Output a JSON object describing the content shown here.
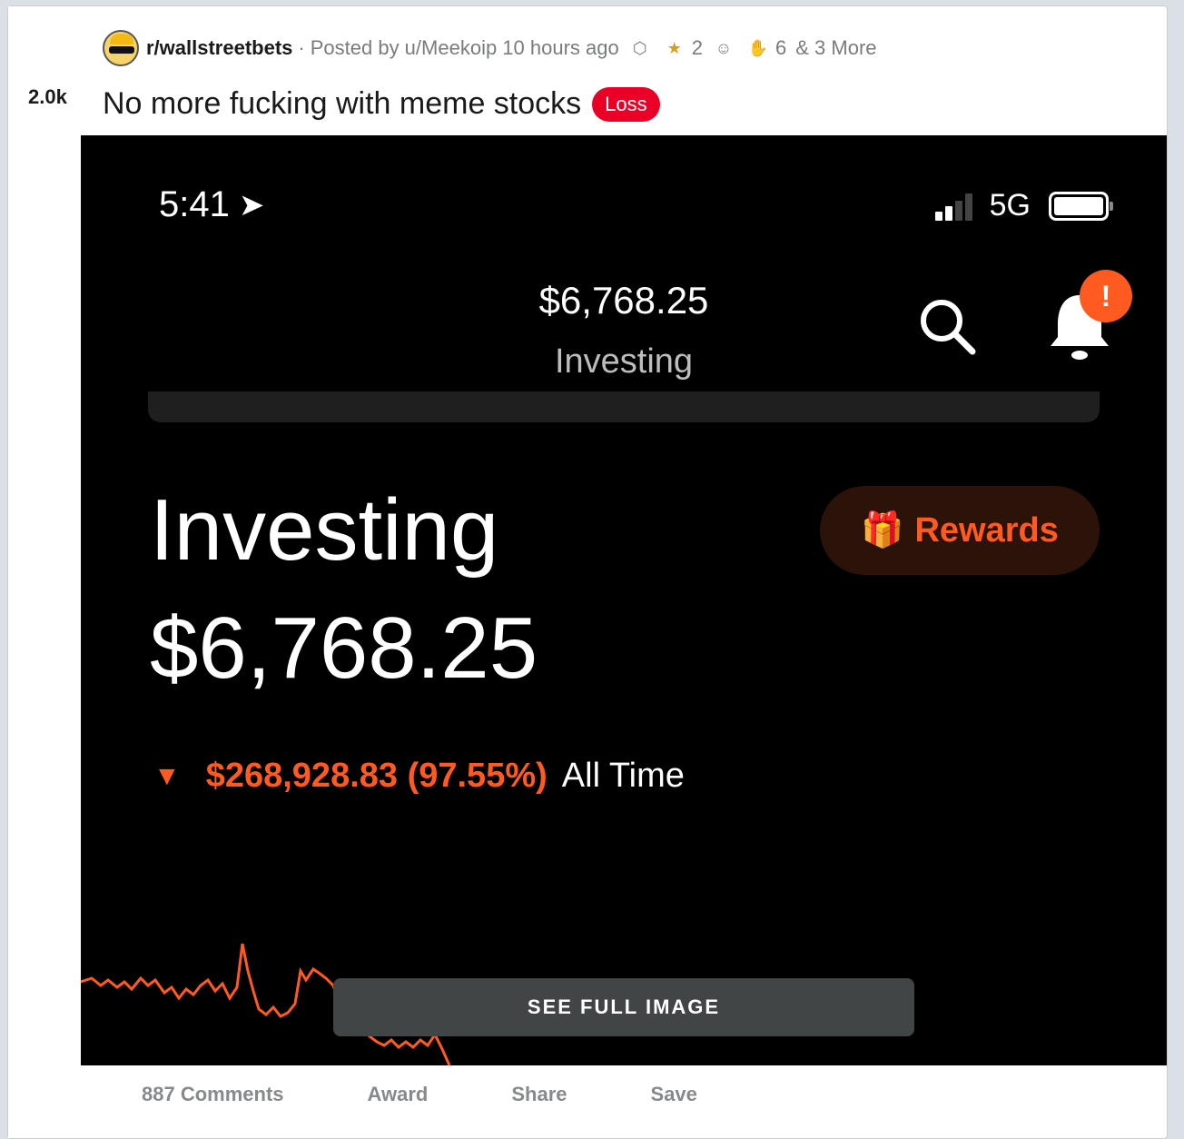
{
  "post": {
    "votes": "2.0k",
    "subreddit": "r/wallstreetbets",
    "separator": "·",
    "posted_by": "Posted by u/Meekoip 10 hours ago",
    "awards": [
      {
        "icon": "shield-award-icon",
        "glyph": "⬡",
        "count": ""
      },
      {
        "icon": "star-award-icon",
        "glyph": "★",
        "count": "2"
      },
      {
        "icon": "snoo-award-icon",
        "glyph": "☺",
        "count": ""
      },
      {
        "icon": "hand-award-icon",
        "glyph": "✋",
        "count": "6"
      }
    ],
    "awards_more": "& 3 More",
    "title": "No more fucking with meme stocks",
    "flair": "Loss",
    "flair_color": "#ea0027"
  },
  "screenshot": {
    "time": "5:41",
    "network": "5G",
    "top_amount": "$6,768.25",
    "top_label": "Investing",
    "notification_badge": "!",
    "heading": "Investing",
    "amount": "$6,768.25",
    "rewards_label": "Rewards",
    "change_value": "$268,928.83 (97.55%)",
    "change_period": "All Time",
    "accent_color": "#ff5a1f"
  },
  "see_full_image": "SEE FULL IMAGE",
  "actions": {
    "comments": "887 Comments",
    "award": "Award",
    "share": "Share",
    "save": "Save"
  }
}
